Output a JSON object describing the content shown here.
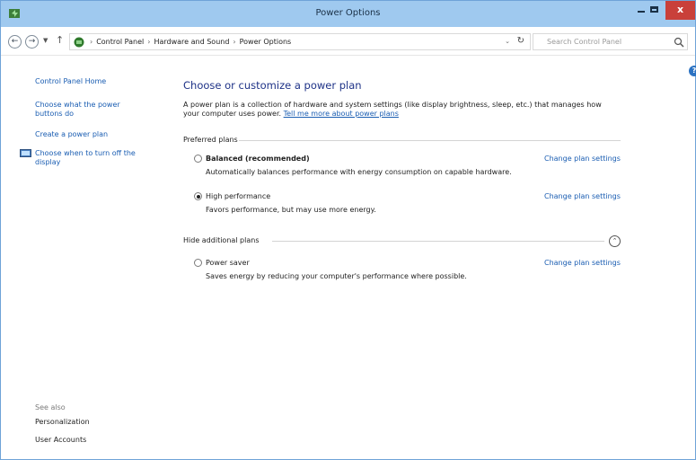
{
  "window": {
    "title": "Power Options",
    "close_label": "x"
  },
  "address": {
    "crumbs": [
      "Control Panel",
      "Hardware and Sound",
      "Power Options"
    ],
    "search_placeholder": "Search Control Panel"
  },
  "left_pane": {
    "home": "Control Panel Home",
    "items": [
      "Choose what the power buttons do",
      "Create a power plan",
      "Choose when to turn off the display"
    ],
    "see_also_label": "See also",
    "see_also": [
      "Personalization",
      "User Accounts"
    ]
  },
  "main": {
    "heading": "Choose or customize a power plan",
    "description": "A power plan is a collection of hardware and system settings (like display brightness, sleep, etc.) that manages how your computer uses power.",
    "description_link": "Tell me more about power plans",
    "preferred_label": "Preferred plans",
    "hide_label": "Hide additional plans",
    "plans": [
      {
        "name": "Balanced (recommended)",
        "description": "Automatically balances performance with energy consumption on capable hardware.",
        "link": "Change plan settings",
        "selected": false
      },
      {
        "name": "High performance",
        "description": "Favors performance, but may use more energy.",
        "link": "Change plan settings",
        "selected": true
      },
      {
        "name": "Power saver",
        "description": "Saves energy by reducing your computer's performance where possible.",
        "link": "Change plan settings",
        "selected": false
      }
    ]
  },
  "colors": {
    "titlebar": "#9fc9ef",
    "close": "#c9403a",
    "link": "#1a5db2",
    "heading": "#1e3287"
  },
  "icons": [
    "power-options-icon",
    "back-icon",
    "forward-icon",
    "up-icon",
    "control-panel-icon",
    "refresh-icon",
    "search-icon",
    "help-icon",
    "display-icon",
    "collapse-icon"
  ]
}
